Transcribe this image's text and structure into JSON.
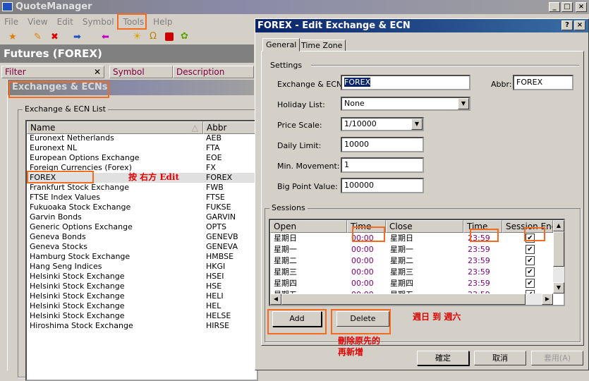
{
  "main": {
    "title": "QuoteManager",
    "menu": [
      "File",
      "View",
      "Edit",
      "Symbol",
      "Tools",
      "Help"
    ],
    "panel_title": "Futures (FOREX)",
    "filter_label": "Filter",
    "columns": [
      "Symbol",
      "Description"
    ],
    "exchanges_title": "Exchanges & ECNs",
    "list_group": "Exchange & ECN List",
    "list_columns": [
      "Name",
      "Abbr"
    ],
    "rows": [
      [
        "Euronext Netherlands",
        "AEB"
      ],
      [
        "Euronext NL",
        "FTA"
      ],
      [
        "European Options Exchange",
        "EOE"
      ],
      [
        "Foreign Currencies (Forex)",
        "FX"
      ],
      [
        "FOREX",
        "FOREX"
      ],
      [
        "Frankfurt Stock Exchange",
        "FWB"
      ],
      [
        "FTSE Index Values",
        "FTSE"
      ],
      [
        "Fukuoaka Stock Exchange",
        "FUKSE"
      ],
      [
        "Garvin Bonds",
        "GARVIN"
      ],
      [
        "Generic Options Exchange",
        "OPTS"
      ],
      [
        "Geneva Bonds",
        "GENEVB"
      ],
      [
        "Geneva Stocks",
        "GENEVA"
      ],
      [
        "Hamburg Stock Exchange",
        "HMBSE"
      ],
      [
        "Hang Seng Indices",
        "HKGI"
      ],
      [
        "Helsinki Stock Exchange",
        "HSEI"
      ],
      [
        "Helsinki Stock Exchange",
        "HSE"
      ],
      [
        "Helsinki Stock Exchange",
        "HELI"
      ],
      [
        "Helsinki Stock Exchange",
        "HEL"
      ],
      [
        "Helsinki Stock Exchange",
        "HELSE"
      ],
      [
        "Hiroshima Stock Exchange",
        "HIRSE"
      ]
    ],
    "annotation": "按 右方 Edit"
  },
  "dialog": {
    "title": "FOREX - Edit Exchange & ECN",
    "tabs": [
      "General",
      "Time Zone"
    ],
    "settings_label": "Settings",
    "fields": {
      "exchange_label": "Exchange & ECN:",
      "exchange": "FOREX",
      "abbr_label": "Abbr:",
      "abbr": "FOREX",
      "holiday_label": "Holiday List:",
      "holiday": "None",
      "price_label": "Price Scale:",
      "price": "1/10000",
      "daily_label": "Daily Limit:",
      "daily": "10000",
      "min_label": "Min. Movement:",
      "min": "1",
      "bpv_label": "Big Point Value:",
      "bpv": "100000"
    },
    "sessions_label": "Sessions",
    "session_columns": [
      "Open",
      "Time",
      "Close",
      "Time",
      "Session End"
    ],
    "sessions": [
      [
        "星期日",
        "00:00",
        "星期日",
        "23:59"
      ],
      [
        "星期一",
        "00:00",
        "星期一",
        "23:59"
      ],
      [
        "星期二",
        "00:00",
        "星期二",
        "23:59"
      ],
      [
        "星期三",
        "00:00",
        "星期三",
        "23:59"
      ],
      [
        "星期四",
        "00:00",
        "星期四",
        "23:59"
      ],
      [
        "星期五",
        "00:00",
        "星期五",
        "23:59"
      ]
    ],
    "add": "Add",
    "delete": "Delete",
    "ok": "確定",
    "cancel": "取消",
    "apply": "套用(A)",
    "note1": "週日 到 週六",
    "note2": "刪除原先的",
    "note3": "再新增"
  },
  "colors": {
    "highlight": "#f26b21",
    "annotation": "#e00000"
  }
}
